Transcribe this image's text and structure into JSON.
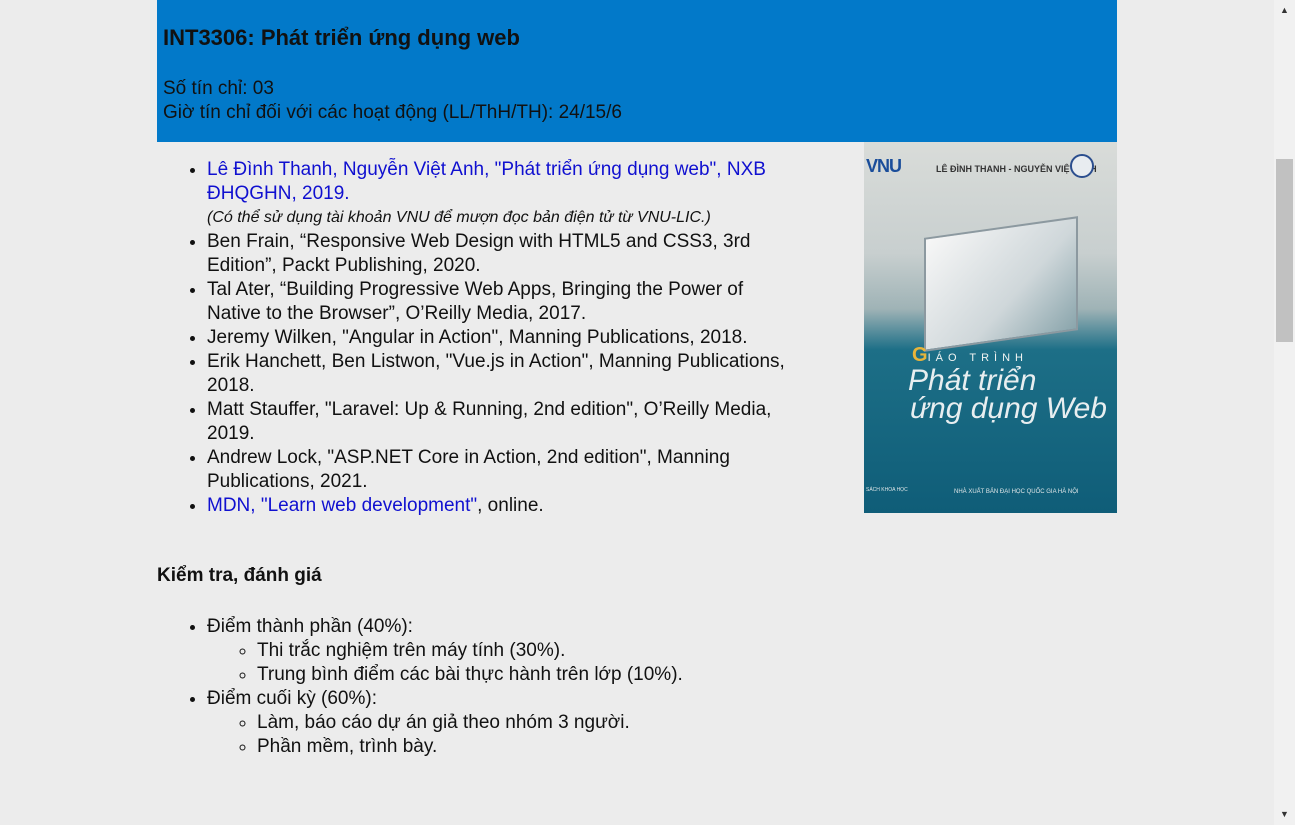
{
  "course": {
    "title": "INT3306: Phát triển ứng dụng web",
    "credits": "Số tín chỉ: 03",
    "hours": "Giờ tín chỉ đối với các hoạt động (LL/ThH/TH): 24/15/6"
  },
  "references": [
    {
      "link": "Lê Đình Thanh, Nguyễn Việt Anh, \"Phát triển ứng dụng web\", NXB ĐHQGHN, 2019.",
      "note": "(Có thể sử dụng tài khoản VNU để mượn đọc bản điện tử từ VNU-LIC.)"
    },
    {
      "text": "Ben Frain, “Responsive Web Design with HTML5 and CSS3, 3rd Edition”, Packt Publishing, 2020."
    },
    {
      "text": "Tal Ater, “Building Progressive Web Apps, Bringing the Power of Native to the Browser”, O’Reilly Media, 2017."
    },
    {
      "text": "Jeremy Wilken, \"Angular in Action\", Manning Publications, 2018."
    },
    {
      "text": "Erik Hanchett, Ben Listwon, \"Vue.js in Action\", Manning Publications, 2018."
    },
    {
      "text": "Matt Stauffer, \"Laravel: Up & Running, 2nd edition\", O’Reilly Media, 2019."
    },
    {
      "text": "Andrew Lock, \"ASP.NET Core in Action, 2nd edition\", Manning Publications, 2021."
    },
    {
      "link": "MDN, \"Learn web development\"",
      "text": ", online."
    }
  ],
  "book_cover": {
    "publisher_logo": "VNU",
    "authors": "LÊ ĐÌNH THANH - NGUYỄN VIỆT ANH",
    "series_initial": "G",
    "series_rest": "IÁO TRÌNH",
    "title_line1": "Phát triển",
    "title_line2": "ứng dụng Web",
    "footer": "NHÀ XUẤT BẢN ĐẠI HỌC QUỐC GIA HÀ NỘI",
    "footer_left": "SÁCH KHOA HỌC"
  },
  "assessment": {
    "heading": "Kiểm tra, đánh giá",
    "items": [
      {
        "label": "Điểm thành phần (40%):",
        "sub": [
          "Thi trắc nghiệm trên máy tính (30%).",
          "Trung bình điểm các bài thực hành trên lớp (10%)."
        ]
      },
      {
        "label": "Điểm cuối kỳ (60%):",
        "sub": [
          "Làm, báo cáo dự án giả theo nhóm 3 người.",
          "Phần mềm, trình bày."
        ]
      }
    ]
  },
  "scrollbar": {
    "up_icon": "▲",
    "down_icon": "▼"
  }
}
